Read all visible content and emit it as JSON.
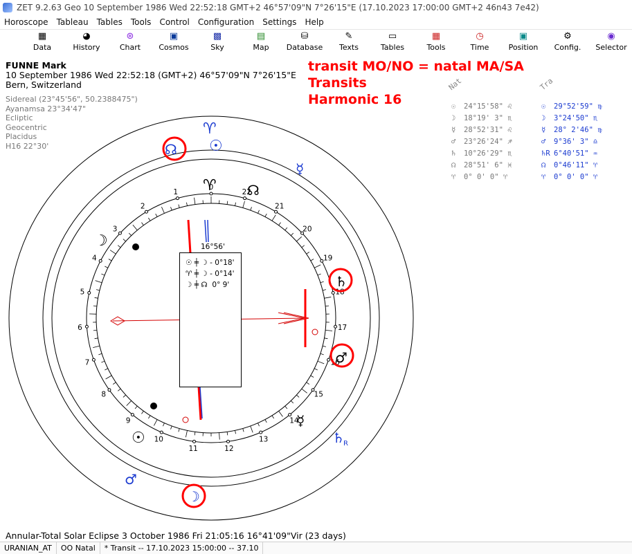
{
  "window": {
    "title": "ZET 9.2.63 Geo   10 September 1986  Wed  22:52:18 GMT+2 46°57'09\"N  7°26'15\"E  (17.10.2023  17:00:00 GMT+2 46n43 7e42)"
  },
  "menu": [
    "Horoscope",
    "Tableau",
    "Tables",
    "Tools",
    "Control",
    "Configuration",
    "Settings",
    "Help"
  ],
  "toolbar": [
    {
      "label": "Data",
      "icon": "table-icon"
    },
    {
      "label": "History",
      "icon": "globe-icon"
    },
    {
      "label": "Chart",
      "icon": "chart-wheel-icon"
    },
    {
      "label": "Cosmos",
      "icon": "cosmos-icon"
    },
    {
      "label": "Sky",
      "icon": "sky-icon"
    },
    {
      "label": "Map",
      "icon": "map-icon"
    },
    {
      "label": "Database",
      "icon": "database-icon"
    },
    {
      "label": "Texts",
      "icon": "texts-icon"
    },
    {
      "label": "Tables",
      "icon": "tables-icon"
    },
    {
      "label": "Tools",
      "icon": "tools-icon"
    },
    {
      "label": "Time",
      "icon": "time-icon"
    },
    {
      "label": "Position",
      "icon": "position-icon"
    },
    {
      "label": "Config.",
      "icon": "config-icon"
    },
    {
      "label": "Selector",
      "icon": "selector-icon"
    }
  ],
  "person": {
    "name": "FUNNE Mark",
    "datetime": "10 September 1986  Wed  22:52:18 (GMT+2) 46°57'09\"N  7°26'15\"E",
    "place": "Bern, Switzerland"
  },
  "settings": [
    "Sidereal (23°45'56\", 50.2388475\")",
    "Ayanamsa 23°34'47\"",
    "Ecliptic",
    "Geocentric",
    "Placidus",
    "H16  22°30'"
  ],
  "annotation": [
    "transit MO/NO = natal MA/SA",
    "Transits",
    "Harmonic 16"
  ],
  "positions": {
    "natal_header": "Nat",
    "transit_header": "Tra",
    "rows": [
      {
        "n_sym": "☉",
        "n_val": "24°15'58\" ♌",
        "t_sym": "☉",
        "t_val": "29°52'59\" ♍"
      },
      {
        "n_sym": "☽",
        "n_val": "18°19' 3\" ♏",
        "t_sym": "☽",
        "t_val": "3°24'50\" ♏"
      },
      {
        "n_sym": "☿",
        "n_val": "28°52'31\" ♌",
        "t_sym": "☿",
        "t_val": "28° 2'46\" ♍"
      },
      {
        "n_sym": "♂",
        "n_val": "23°26'24\" ♐",
        "t_sym": "♂",
        "t_val": "9°36' 3\" ♎"
      },
      {
        "n_sym": "♄",
        "n_val": "10°26'29\" ♏",
        "t_sym": "♄R",
        "t_val": "6°40'51\" ♒"
      },
      {
        "n_sym": "☊",
        "n_val": "28°51' 6\" ♓",
        "t_sym": "☊",
        "t_val": "0°46'11\" ♈"
      },
      {
        "n_sym": "♈",
        "n_val": "0° 0' 0\" ♈",
        "t_sym": "♈",
        "t_val": "0° 0' 0\" ♈"
      }
    ]
  },
  "chart": {
    "center_label": "16°56'",
    "aspects": [
      {
        "text": "☉ ╪ ☽ - 0°18'"
      },
      {
        "text": "♈ ╪ ☽ - 0°14'"
      },
      {
        "text": "☽ ╪ ☊  0° 9'"
      }
    ],
    "numbers": [
      "0",
      "1",
      "2",
      "3",
      "4",
      "5",
      "6",
      "7",
      "8",
      "9",
      "10",
      "11",
      "12",
      "13",
      "14",
      "15",
      "16",
      "17",
      "18",
      "19",
      "20",
      "21",
      "22"
    ],
    "colors": {
      "highlight": "#ff0000",
      "transit": "#1a3ad0",
      "natal": "#000000"
    }
  },
  "footer": {
    "eclipse": "Annular-Total Solar Eclipse 3 October 1986 Fri 21:05:16 16°41'09\"Vir (23 days)"
  },
  "status": [
    "URANIAN_AT",
    "OO Natal",
    "*  Transit -- 17.10.2023 15:00:00 -- 37.10"
  ]
}
